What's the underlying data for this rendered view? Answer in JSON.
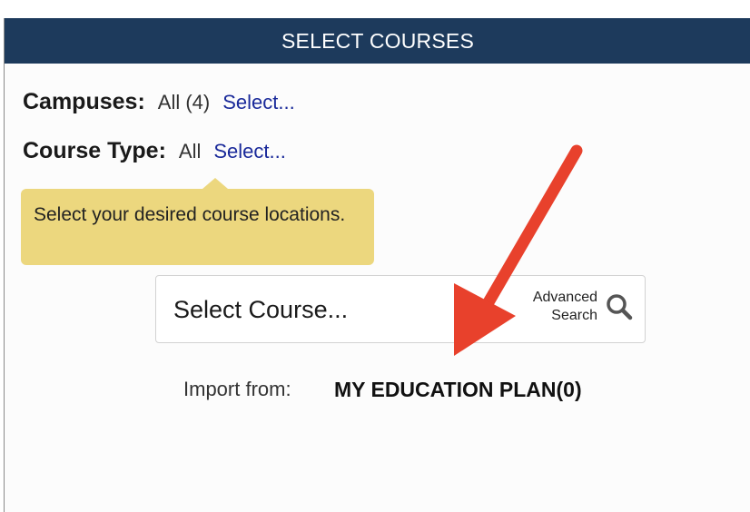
{
  "header": {
    "title": "SELECT COURSES"
  },
  "filters": {
    "campuses": {
      "label": "Campuses:",
      "value": "All (4)",
      "link": "Select..."
    },
    "course_type": {
      "label": "Course Type:",
      "value": "All",
      "link": "Select..."
    }
  },
  "tooltip": {
    "text": "Select your desired course locations."
  },
  "search": {
    "placeholder": "Select Course...",
    "advanced_line1": "Advanced",
    "advanced_line2": "Search"
  },
  "import": {
    "label": "Import from:",
    "link": "MY EDUCATION PLAN(0)"
  },
  "colors": {
    "header_bg": "#1d3a5c",
    "link": "#1a2a9a",
    "tooltip_bg": "#ecd77e",
    "annotation_arrow": "#e8412c"
  },
  "icons": {
    "search": "magnifier-icon",
    "annotation": "red-arrow-annotation"
  }
}
